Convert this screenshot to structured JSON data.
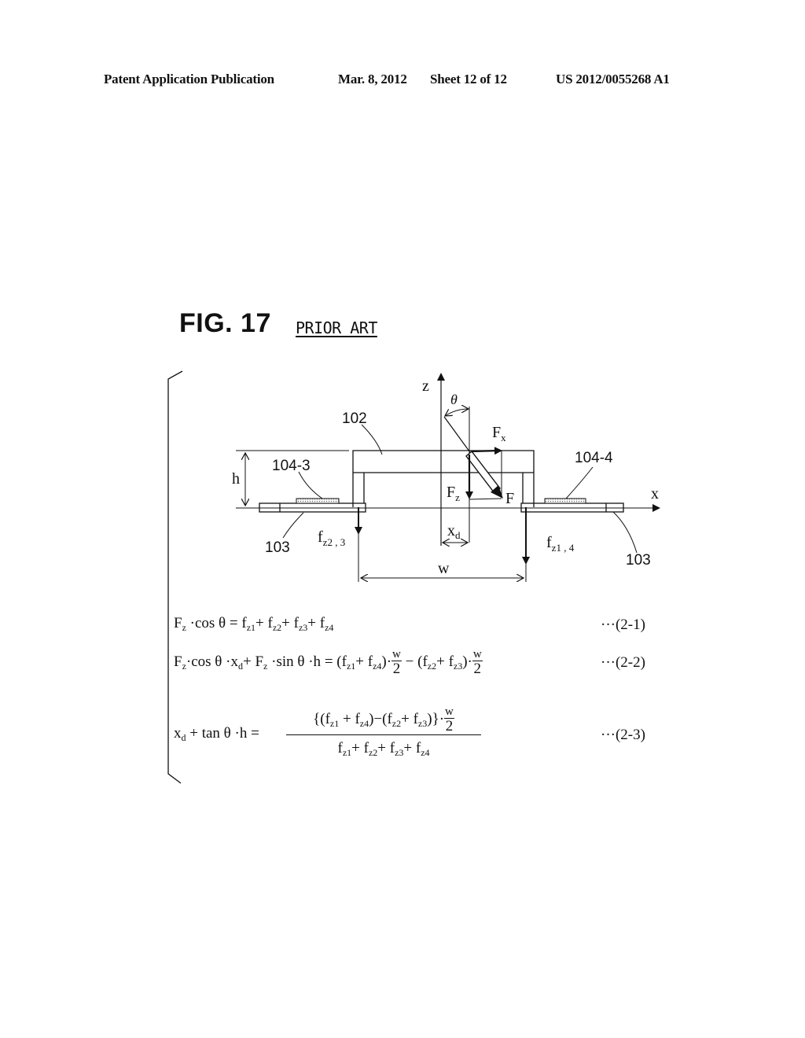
{
  "header": {
    "publication": "Patent Application Publication",
    "date": "Mar. 8, 2012",
    "sheet": "Sheet 12 of 12",
    "number": "US 2012/0055268 A1"
  },
  "figure": {
    "title": "FIG. 17",
    "subtitle": "PRIOR ART"
  },
  "diagram": {
    "axis_z": "z",
    "axis_x": "x",
    "angle": "θ",
    "height_label": "h",
    "width_label": "w",
    "force": "F",
    "force_x": "F",
    "force_x_sub": "x",
    "force_z": "F",
    "force_z_sub": "z",
    "offset": "x",
    "offset_sub": "d",
    "part_102": "102",
    "sensor_left": "104-3",
    "sensor_right": "104-4",
    "base_left": "103",
    "base_right": "103",
    "reaction_left": "f",
    "reaction_left_sub": "z2 , 3",
    "reaction_right": "f",
    "reaction_right_sub": "z1 , 4"
  },
  "equations": [
    {
      "number": "···(2-1)"
    },
    {
      "number": "···(2-2)"
    },
    {
      "number": "···(2-3)"
    }
  ],
  "eq_terms": {
    "F": "F",
    "z": "z",
    "cos": "·cos θ",
    "eq": " = ",
    "f": "f",
    "plus": "+ ",
    "z1": "z1",
    "z2": "z2",
    "z3": "z3",
    "z4": "z4",
    "xd_term": "·x",
    "d": "d",
    "sin": "·sin θ ·h",
    "w": "w",
    "two": "2",
    "x": "x",
    "tan": " + tan θ ·h ="
  }
}
